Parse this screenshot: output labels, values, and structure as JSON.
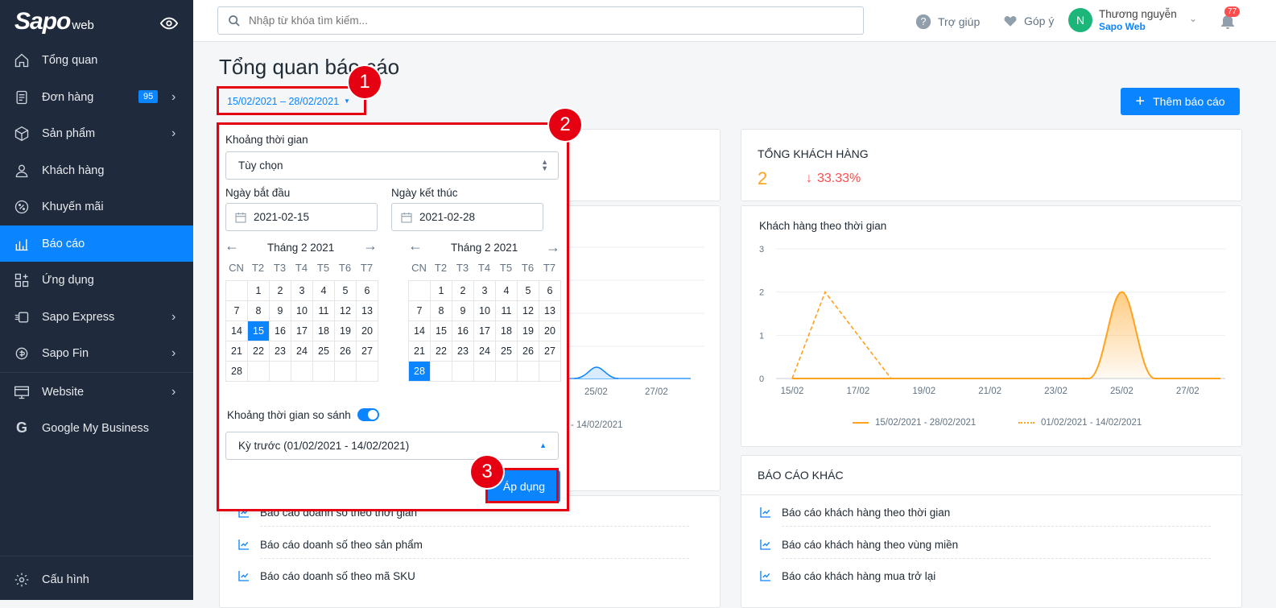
{
  "app": {
    "logo": "Sapo",
    "logo_suffix": "web"
  },
  "sidebar": {
    "items": [
      {
        "label": "Tổng quan",
        "icon": "home-icon"
      },
      {
        "label": "Đơn hàng",
        "icon": "orders-icon",
        "badge": "95"
      },
      {
        "label": "Sản phẩm",
        "icon": "box-icon"
      },
      {
        "label": "Khách hàng",
        "icon": "user-icon"
      },
      {
        "label": "Khuyến mãi",
        "icon": "discount-icon"
      },
      {
        "label": "Báo cáo",
        "icon": "report-icon",
        "active": true
      },
      {
        "label": "Ứng dụng",
        "icon": "apps-icon"
      },
      {
        "label": "Sapo Express",
        "icon": "express-icon"
      },
      {
        "label": "Sapo Fin",
        "icon": "fin-icon"
      },
      {
        "label": "Website",
        "icon": "website-icon"
      },
      {
        "label": "Google My Business",
        "icon": "google-icon"
      },
      {
        "label": "Cấu hình",
        "icon": "gear-icon"
      }
    ]
  },
  "topbar": {
    "search_placeholder": "Nhập từ khóa tìm kiếm...",
    "help": "Trợ giúp",
    "feedback": "Góp ý",
    "user_initial": "N",
    "user_name": "Thương nguyễn",
    "user_org": "Sapo Web",
    "notif_count": "77"
  },
  "page": {
    "title": "Tổng quan báo cáo",
    "date_range": "15/02/2021 – 28/02/2021",
    "add_report": "Thêm báo cáo"
  },
  "right_card": {
    "title": "TỔNG KHÁCH HÀNG",
    "value": "2",
    "delta": "33.33%",
    "chart_title": "Khách hàng theo thời gian",
    "legend_current": "15/02/2021 - 28/02/2021",
    "legend_previous": "01/02/2021 - 14/02/2021"
  },
  "left_partial": {
    "xlabels": [
      "25/02",
      "27/02"
    ],
    "legend_tail": "- 14/02/2021"
  },
  "chart_data": {
    "type": "line",
    "x": [
      "15/02",
      "17/02",
      "19/02",
      "21/02",
      "23/02",
      "25/02",
      "27/02"
    ],
    "ylim": [
      0,
      3
    ],
    "yticks": [
      "0",
      "1",
      "2",
      "3"
    ],
    "series": [
      {
        "name": "15/02/2021 - 28/02/2021",
        "color": "#ffa21d",
        "style": "area",
        "points": [
          [
            15,
            0
          ],
          [
            24,
            0
          ],
          [
            25,
            2
          ],
          [
            26,
            0
          ],
          [
            28,
            0
          ]
        ]
      },
      {
        "name": "01/02/2021 - 14/02/2021",
        "color": "#ffa21d",
        "style": "dashed",
        "points": [
          [
            15,
            0
          ],
          [
            16,
            2
          ],
          [
            18,
            0
          ]
        ]
      }
    ]
  },
  "other_reports": {
    "title": "BÁO CÁO KHÁC",
    "items": [
      "Báo cáo khách hàng theo thời gian",
      "Báo cáo khách hàng theo vùng miền",
      "Báo cáo khách hàng mua trở lại"
    ]
  },
  "left_reports": {
    "items": [
      "Báo cáo doanh số theo thời gian",
      "Báo cáo doanh số theo sản phẩm",
      "Báo cáo doanh số theo mã SKU"
    ]
  },
  "popup": {
    "period_label": "Khoảng thời gian",
    "period_value": "Tùy chọn",
    "start_label": "Ngày bắt đầu",
    "start_value": "2021-02-15",
    "end_label": "Ngày kết thúc",
    "end_value": "2021-02-28",
    "month_left": "Tháng 2 2021",
    "month_right": "Tháng 2 2021",
    "dow": [
      "CN",
      "T2",
      "T3",
      "T4",
      "T5",
      "T6",
      "T7"
    ],
    "weeks": [
      [
        "",
        "1",
        "2",
        "3",
        "4",
        "5",
        "6"
      ],
      [
        "7",
        "8",
        "9",
        "10",
        "11",
        "12",
        "13"
      ],
      [
        "14",
        "15",
        "16",
        "17",
        "18",
        "19",
        "20"
      ],
      [
        "21",
        "22",
        "23",
        "24",
        "25",
        "26",
        "27"
      ],
      [
        "28",
        "",
        "",
        "",
        "",
        "",
        ""
      ]
    ],
    "selected_left": "15",
    "selected_right": "28",
    "compare_label": "Khoảng thời gian so sánh",
    "compare_enabled": true,
    "compare_value": "Kỳ trước (01/02/2021 - 14/02/2021)",
    "apply": "Áp dụng"
  },
  "annotations": [
    "1",
    "2",
    "3"
  ],
  "colors": {
    "sidebar": "#1f2a3c",
    "accent": "#0a84ff",
    "orange": "#ffa21d",
    "red": "#ff4d4d",
    "marker": "#e50012"
  }
}
